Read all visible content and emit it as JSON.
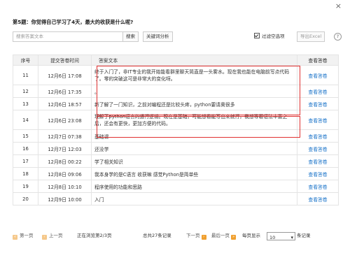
{
  "dialog": {
    "close_glyph": "×"
  },
  "question": "第5题：你觉得自己学习了4天，最大的收获是什么呢?",
  "toolbar": {
    "search_placeholder": "搜索答案文本",
    "search_btn": "搜索",
    "keyword_btn": "关键词分析",
    "filter_label": "过滤空选项",
    "filter_checked": true,
    "export_btn": "导出Excel",
    "help_glyph": "?"
  },
  "table": {
    "headers": [
      "序号",
      "提交答卷时间",
      "答案文本",
      "查看答卷"
    ],
    "rows": [
      {
        "no": "11",
        "time": "12月6日 17:08",
        "answer": "终于入门了，非IT专业的我开始能看群里聊天简直是一头雾水。现在我也能在电脑前写点代码了。零的突破这可是非常大的变化呀。",
        "view": "查看答卷"
      },
      {
        "no": "12",
        "time": "12月6日 17:35",
        "answer": "。",
        "view": "查看答卷"
      },
      {
        "no": "13",
        "time": "12月6日 18:57",
        "answer": "新了解了一门知识，之前对编程还是比较头疼，python要请奥很多",
        "view": "查看答卷"
      },
      {
        "no": "14",
        "time": "12月6日 23:08",
        "answer": "理解了python语言的运行逻辑。现在是基础，可能想看能写出来就行，我想等着语法丰富之后，还会有更快，更加方便的代码。",
        "view": "查看答卷"
      },
      {
        "no": "15",
        "time": "12月7日 07:38",
        "answer": "基础课",
        "view": "查看答卷"
      },
      {
        "no": "16",
        "time": "12月7日 12:03",
        "answer": "还没学",
        "view": "查看答卷"
      },
      {
        "no": "17",
        "time": "12月8日 00:22",
        "answer": "学了相关知识",
        "view": "查看答卷"
      },
      {
        "no": "18",
        "time": "12月8日 09:06",
        "answer": "我本身学的是C语言 收获嘛 感觉Python是简单些",
        "view": "查看答卷"
      },
      {
        "no": "19",
        "time": "12月8日 10:10",
        "answer": "程序使用的功能和思路",
        "view": "查看答卷"
      },
      {
        "no": "20",
        "time": "12月9日 10:00",
        "answer": "入门",
        "view": "查看答卷"
      }
    ]
  },
  "pager": {
    "first": "第一页",
    "prev": "上一页",
    "status": "正在浏览第2/3页",
    "total": "总共27条记录",
    "next": "下一页",
    "last": "最后一页",
    "per_page_label": "每页显示",
    "per_page_value": "10",
    "per_page_unit": "条记录"
  },
  "colors": {
    "accent": "#1a73c9",
    "highlight": "#e03030",
    "pager_btn": "#f0a030"
  }
}
